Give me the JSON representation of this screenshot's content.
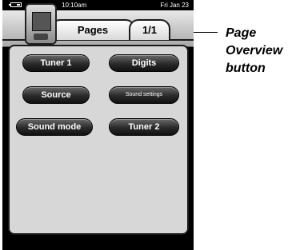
{
  "status_bar": {
    "time": "10:10am",
    "date": "Fri Jan 23"
  },
  "header": {
    "pages_tab_label": "Pages",
    "page_overview_label": "1/1"
  },
  "buttons": {
    "tuner1": "Tuner 1",
    "digits": "Digits",
    "source": "Source",
    "sound_settings": "Sound settings",
    "sound_mode": "Sound mode",
    "tuner2": "Tuner 2"
  },
  "callout": {
    "line1": "Page",
    "line2": "Overview",
    "line3": "button"
  },
  "icons": [
    "battery-icon",
    "device-icon"
  ]
}
